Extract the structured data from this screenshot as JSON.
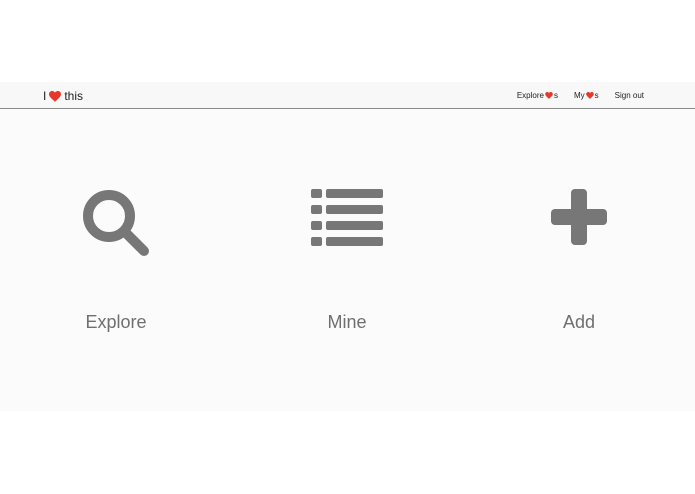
{
  "navbar": {
    "brand": {
      "prefix": "I",
      "suffix": "this"
    },
    "links": [
      {
        "prefix": "Explore",
        "suffix": "s"
      },
      {
        "prefix": "My",
        "suffix": "s"
      },
      {
        "label": "Sign out"
      }
    ]
  },
  "tiles": [
    {
      "label": "Explore",
      "icon": "search-icon"
    },
    {
      "label": "Mine",
      "icon": "list-icon"
    },
    {
      "label": "Add",
      "icon": "plus-icon"
    }
  ],
  "colors": {
    "heart": "#e8382c",
    "icon": "#777777",
    "label": "#6f6f6f"
  }
}
